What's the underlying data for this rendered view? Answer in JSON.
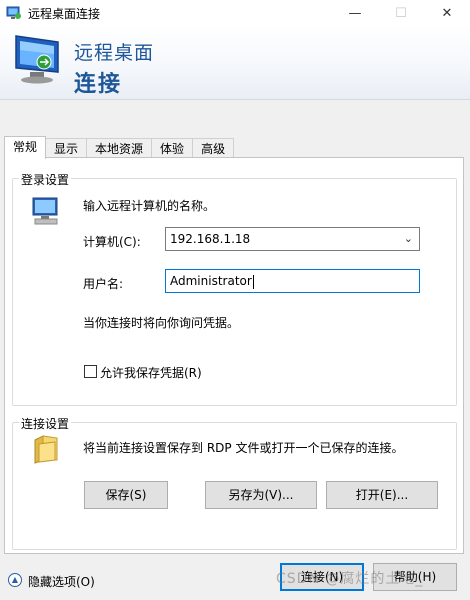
{
  "window": {
    "title": "远程桌面连接",
    "minimize_label": "—",
    "maximize_label": "☐",
    "close_label": "✕"
  },
  "banner": {
    "line1": "远程桌面",
    "line2": "连接"
  },
  "tabs": [
    {
      "label": "常规",
      "active": true
    },
    {
      "label": "显示",
      "active": false
    },
    {
      "label": "本地资源",
      "active": false
    },
    {
      "label": "体验",
      "active": false
    },
    {
      "label": "高级",
      "active": false
    }
  ],
  "logon": {
    "group_label": "登录设置",
    "instruction": "输入远程计算机的名称。",
    "computer_label": "计算机(C):",
    "computer_value": "192.168.1.18",
    "username_label": "用户名:",
    "username_value": "Administrator",
    "prompt_note": "当你连接时将向你询问凭据。",
    "save_credentials_label": "允许我保存凭据(R)",
    "save_credentials_checked": false
  },
  "connection": {
    "group_label": "连接设置",
    "description": "将当前连接设置保存到 RDP 文件或打开一个已保存的连接。",
    "save_button": "保存(S)",
    "save_as_button": "另存为(V)...",
    "open_button": "打开(E)..."
  },
  "footer": {
    "hide_options_label": "隐藏选项(O)",
    "connect_button": "连接(N)",
    "help_button": "帮助(H)"
  },
  "watermark": "CSDN @腐烂的土地_",
  "colors": {
    "accent": "#0078d7",
    "banner_text": "#1e5799"
  }
}
